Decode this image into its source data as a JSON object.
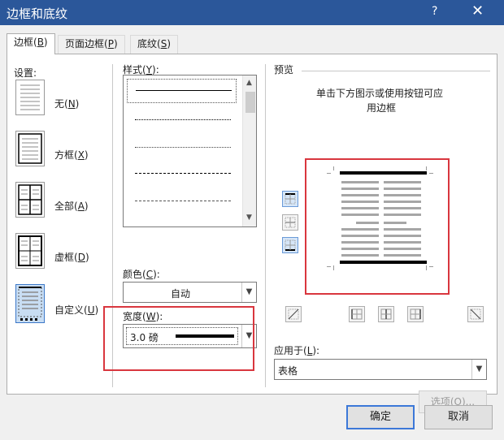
{
  "title": "边框和底纹",
  "help_label": "?",
  "close_label": "✕",
  "tabs": {
    "borders": {
      "text": "边框(",
      "key": "B",
      "end": ")"
    },
    "page_borders": {
      "text": "页面边框(",
      "key": "P",
      "end": ")"
    },
    "shading": {
      "text": "底纹(",
      "key": "S",
      "end": ")"
    }
  },
  "setting": {
    "label": "设置:",
    "none": {
      "text": "无(",
      "key": "N",
      "end": ")"
    },
    "box": {
      "text": "方框(",
      "key": "X",
      "end": ")"
    },
    "all": {
      "text": "全部(",
      "key": "A",
      "end": ")"
    },
    "grid": {
      "text": "虚框(",
      "key": "D",
      "end": ")"
    },
    "custom": {
      "text": "自定义(",
      "key": "U",
      "end": ")"
    }
  },
  "style": {
    "label": "样式(",
    "key": "Y",
    "end": "):"
  },
  "color": {
    "label": "颜色(",
    "key": "C",
    "end": "):",
    "value": "自动"
  },
  "width": {
    "label": "宽度(",
    "key": "W",
    "end": "):",
    "value": "3.0 磅"
  },
  "preview": {
    "label": "预览",
    "hint_line1": "单击下方图示或使用按钮可应",
    "hint_line2": "用边框"
  },
  "apply_to": {
    "label": "应用于(",
    "key": "L",
    "end": "):",
    "value": "表格"
  },
  "options_label": "选项(O)...",
  "ok_label": "确定",
  "cancel_label": "取消",
  "colors": {
    "title_bar": "#2b579a",
    "highlight": "#d9363e",
    "selected": "#c8ddf3"
  }
}
